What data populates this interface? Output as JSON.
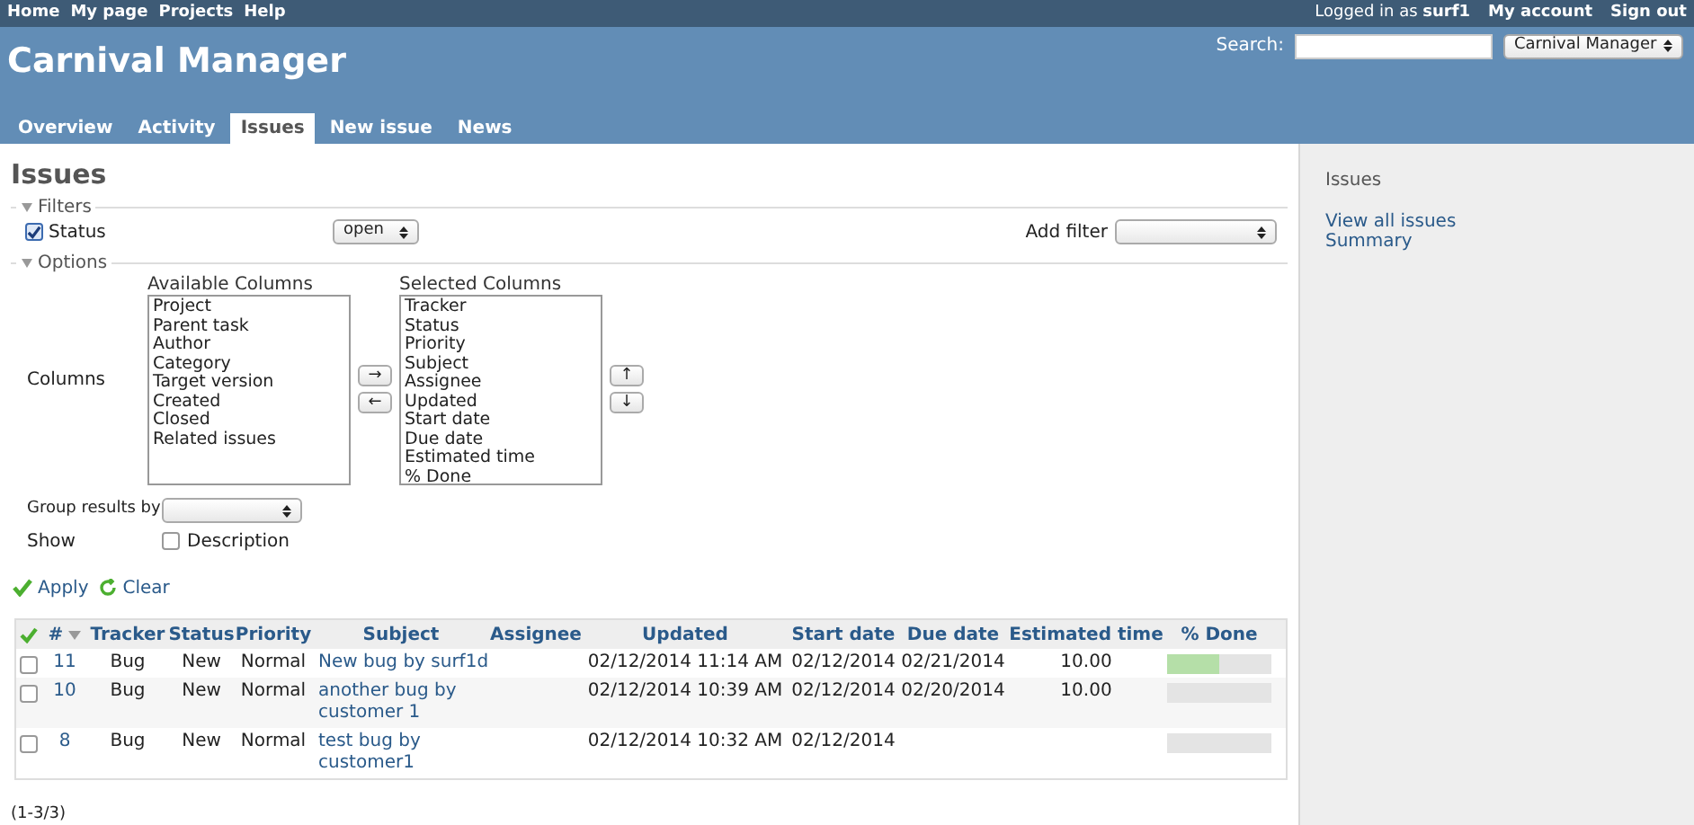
{
  "top_menu": [
    "Home",
    "My page",
    "Projects",
    "Help"
  ],
  "logged_in": {
    "label": "Logged in as",
    "user": "surf1"
  },
  "account_links": [
    "My account",
    "Sign out"
  ],
  "project_title": "Carnival Manager",
  "search": {
    "label": "Search:",
    "project_select": "Carnival Manager"
  },
  "tabs": [
    {
      "label": "Overview",
      "selected": false
    },
    {
      "label": "Activity",
      "selected": false
    },
    {
      "label": "Issues",
      "selected": true
    },
    {
      "label": "New issue",
      "selected": false
    },
    {
      "label": "News",
      "selected": false
    }
  ],
  "page_title": "Issues",
  "filters": {
    "legend": "Filters",
    "status": {
      "label": "Status",
      "checked": true,
      "operator": "open"
    },
    "add_filter_label": "Add filter"
  },
  "options": {
    "legend": "Options",
    "columns_label": "Columns",
    "available_label": "Available Columns",
    "available": [
      "Project",
      "Parent task",
      "Author",
      "Category",
      "Target version",
      "Created",
      "Closed",
      "Related issues"
    ],
    "selected_label": "Selected Columns",
    "selected": [
      "Tracker",
      "Status",
      "Priority",
      "Subject",
      "Assignee",
      "Updated",
      "Start date",
      "Due date",
      "Estimated time",
      "% Done"
    ],
    "move_buttons": [
      "→",
      "←"
    ],
    "order_buttons": [
      "↑",
      "↓"
    ],
    "group_label": "Group results by",
    "show_label": "Show",
    "description": {
      "label": "Description",
      "checked": false
    }
  },
  "actions": [
    "Apply",
    "Clear"
  ],
  "table": {
    "columns": [
      "#",
      "Tracker",
      "Status",
      "Priority",
      "Subject",
      "Assignee",
      "Updated",
      "Start date",
      "Due date",
      "Estimated time",
      "% Done"
    ],
    "rows": [
      {
        "id": "11",
        "tracker": "Bug",
        "status": "New",
        "priority": "Normal",
        "subject": "New bug by surf1d",
        "updated": "02/12/2014 11:14 AM",
        "start": "02/12/2014",
        "due": "02/21/2014",
        "estimated": "10.00",
        "level": 0.5,
        "checked": false
      },
      {
        "id": "10",
        "tracker": "Bug",
        "status": "New",
        "priority": "Normal",
        "subject": "another bug by customer 1",
        "updated": "02/12/2014 10:39 AM",
        "start": "02/12/2014",
        "due": "02/20/2014",
        "estimated": "10.00",
        "level": 0,
        "checked": false
      },
      {
        "id": "8",
        "tracker": "Bug",
        "status": "New",
        "priority": "Normal",
        "subject": "test bug by customer1",
        "updated": "02/12/2014 10:32 AM",
        "start": "02/12/2014",
        "due": "",
        "estimated": "",
        "level": 0,
        "checked": false
      }
    ]
  },
  "pagination": "(1-3/3)",
  "sidebar": {
    "title": "Issues",
    "links": [
      "View all issues",
      "Summary"
    ]
  }
}
